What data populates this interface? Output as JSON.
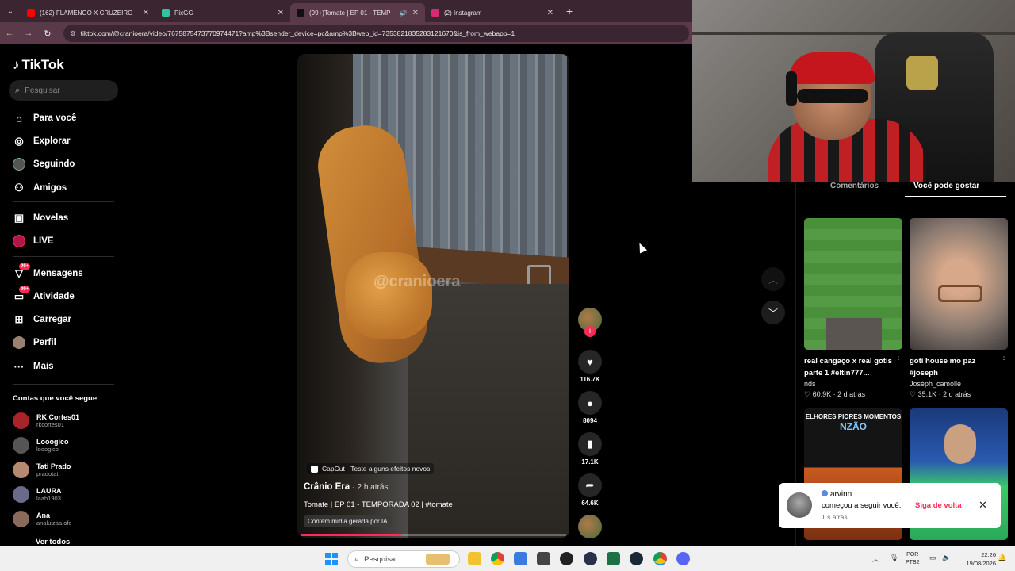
{
  "browser": {
    "tabs": [
      {
        "title": "(162) FLAMENGO X CRUZEIRO",
        "color": "#ff0000",
        "active": false
      },
      {
        "title": "PixGG",
        "color": "#2ec4a0",
        "active": false
      },
      {
        "title": "(99+)Tomate | EP 01 - TEMP",
        "color": "#111111",
        "active": true
      },
      {
        "title": "(2) Instagram",
        "color": "#d62976",
        "active": false
      }
    ],
    "url": "tiktok.com/@cranioera/video/7675875473770974471?amp%3Bsender_device=pc&amp%3Bweb_id=7353821835283121670&is_from_webapp=1"
  },
  "sidebar": {
    "logo": "TikTok",
    "search_placeholder": "Pesquisar",
    "nav": [
      {
        "label": "Para você",
        "icon": "home-icon"
      },
      {
        "label": "Explorar",
        "icon": "compass-icon"
      },
      {
        "label": "Seguindo",
        "icon": "following-icon"
      },
      {
        "label": "Amigos",
        "icon": "friends-icon"
      },
      {
        "label": "Novelas",
        "icon": "series-icon"
      },
      {
        "label": "LIVE",
        "icon": "live-icon"
      },
      {
        "label": "Mensagens",
        "icon": "messages-icon",
        "badge": "99+"
      },
      {
        "label": "Atividade",
        "icon": "activity-icon",
        "badge": "99+"
      },
      {
        "label": "Carregar",
        "icon": "upload-icon"
      },
      {
        "label": "Perfil",
        "icon": "profile-icon"
      },
      {
        "label": "Mais",
        "icon": "more-icon"
      }
    ],
    "following_title": "Contas que você segue",
    "accounts": [
      {
        "name": "RK Cortes01",
        "handle": "rkcortes01",
        "color": "#a8242a"
      },
      {
        "name": "Looogico",
        "handle": "looogico",
        "color": "#555555"
      },
      {
        "name": "Tati Prado",
        "handle": "pradotati_",
        "color": "#b58a70"
      },
      {
        "name": "LAURA",
        "handle": "laah1903",
        "color": "#6a6a8a"
      },
      {
        "name": "Ana",
        "handle": "analuizaa.ofc",
        "color": "#8a6a5a"
      }
    ],
    "see_all": "Ver todos"
  },
  "video": {
    "watermark": "@cranioera",
    "capcut": "CapCut · Teste alguns efeitos novos",
    "author": "Crânio Era",
    "time": "· 2 h atrás",
    "caption": "Tomate | EP 01 - TEMPORADA 02 | #tomate",
    "ai_label": "Contém mídia gerada por IA",
    "progress": 0.38,
    "likes": "116.7K",
    "comments": "8094",
    "saves": "17.1K",
    "shares": "64.6K"
  },
  "right_panel": {
    "tab_comments": "Comentários",
    "tab_suggest": "Você pode gostar",
    "cards": [
      {
        "title": "real cangaço x real gotis parte 1 #eltin777...",
        "user": "nds",
        "likes": "60.9K",
        "time": "2 d atrás"
      },
      {
        "title": "goti house mo paz #joseph",
        "user": "Joséph_camolle",
        "likes": "35.1K",
        "time": "2 d atrás"
      }
    ],
    "thumb3_line1": "ELHORES PIORES MOMENTOS",
    "thumb3_line2": "NZÃO"
  },
  "toast": {
    "name": "arvinn",
    "message": "começou a seguir você.",
    "time": "1 s atrás",
    "action": "Siga de volta"
  },
  "taskbar": {
    "search": "Pesquisar",
    "lang1": "POR",
    "lang2": "PTB2",
    "time": "22:26",
    "date": "19/08/2026"
  }
}
